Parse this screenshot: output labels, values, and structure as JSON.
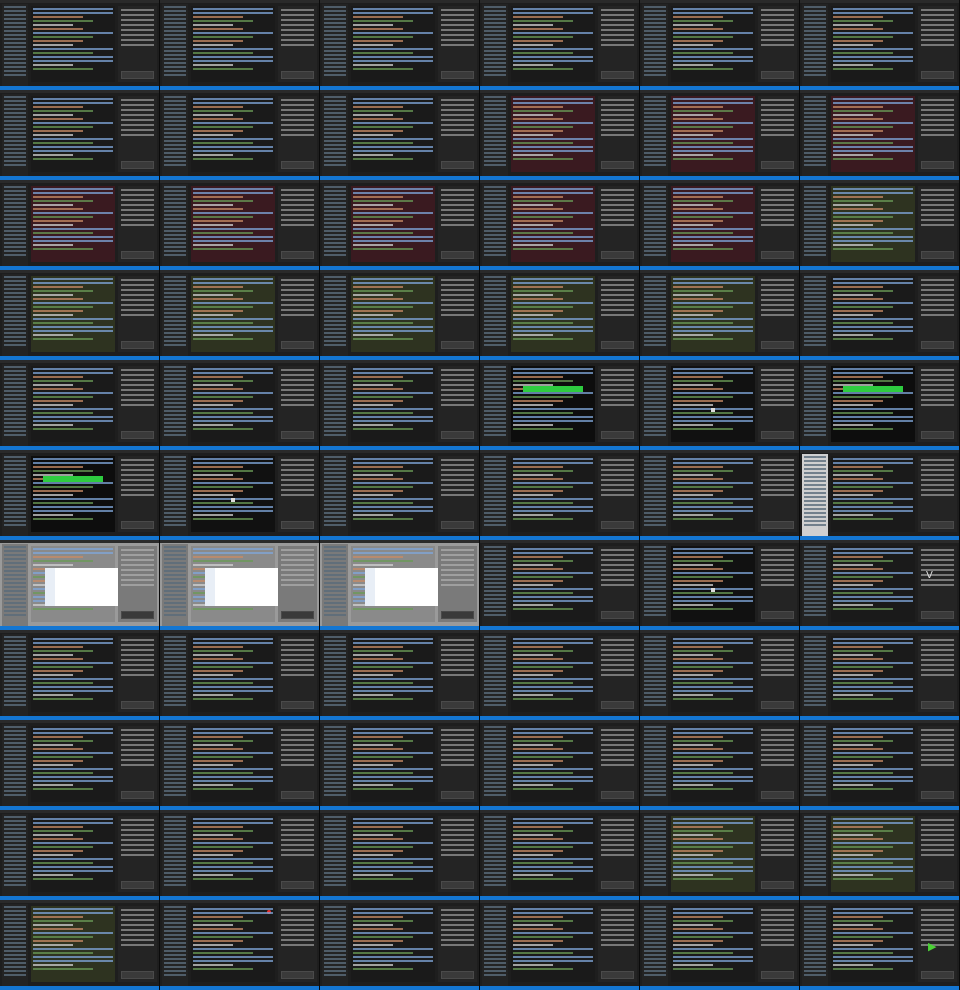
{
  "montage": {
    "rows": 11,
    "cols": 6,
    "tiles": [
      {
        "variant": "code"
      },
      {
        "variant": "code"
      },
      {
        "variant": "code"
      },
      {
        "variant": "code"
      },
      {
        "variant": "code"
      },
      {
        "variant": "code"
      },
      {
        "variant": "code"
      },
      {
        "variant": "code"
      },
      {
        "variant": "code"
      },
      {
        "variant": "diff-red"
      },
      {
        "variant": "diff-red"
      },
      {
        "variant": "diff-red"
      },
      {
        "variant": "diff-red"
      },
      {
        "variant": "diff-red"
      },
      {
        "variant": "diff-red"
      },
      {
        "variant": "diff-red"
      },
      {
        "variant": "diff-red"
      },
      {
        "variant": "diff-olive"
      },
      {
        "variant": "diff-olive"
      },
      {
        "variant": "diff-olive"
      },
      {
        "variant": "diff-olive"
      },
      {
        "variant": "diff-olive"
      },
      {
        "variant": "diff-olive"
      },
      {
        "variant": "code"
      },
      {
        "variant": "code"
      },
      {
        "variant": "code"
      },
      {
        "variant": "code"
      },
      {
        "variant": "terminal"
      },
      {
        "variant": "blank"
      },
      {
        "variant": "terminal"
      },
      {
        "variant": "terminal"
      },
      {
        "variant": "blank"
      },
      {
        "variant": "code"
      },
      {
        "variant": "code"
      },
      {
        "variant": "code"
      },
      {
        "variant": "light-sidebar"
      },
      {
        "variant": "dialog"
      },
      {
        "variant": "dialog"
      },
      {
        "variant": "dialog"
      },
      {
        "variant": "code"
      },
      {
        "variant": "blank"
      },
      {
        "variant": "logo"
      },
      {
        "variant": "code"
      },
      {
        "variant": "code"
      },
      {
        "variant": "code"
      },
      {
        "variant": "code"
      },
      {
        "variant": "code"
      },
      {
        "variant": "code"
      },
      {
        "variant": "code"
      },
      {
        "variant": "code"
      },
      {
        "variant": "code"
      },
      {
        "variant": "code"
      },
      {
        "variant": "code"
      },
      {
        "variant": "code"
      },
      {
        "variant": "code"
      },
      {
        "variant": "code"
      },
      {
        "variant": "code"
      },
      {
        "variant": "code"
      },
      {
        "variant": "diff-olive"
      },
      {
        "variant": "diff-olive"
      },
      {
        "variant": "diff-olive"
      },
      {
        "variant": "red-marker"
      },
      {
        "variant": "code"
      },
      {
        "variant": "code"
      },
      {
        "variant": "code"
      },
      {
        "variant": "play"
      }
    ]
  },
  "colors": {
    "accent": "#1476d2",
    "diff_removed": "#3a1a20",
    "diff_changed": "#2e3320",
    "terminal_green": "#2ecc40"
  }
}
